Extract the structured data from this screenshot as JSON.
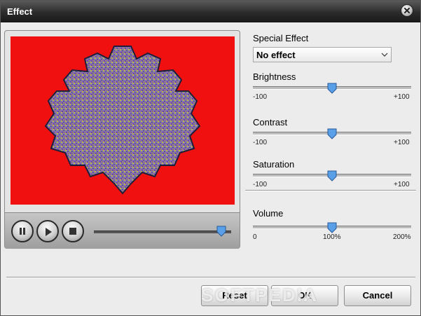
{
  "window": {
    "title": "Effect"
  },
  "player": {
    "video_background": "#f01010",
    "progress": 0.93,
    "icons": {
      "pause": "pause-icon",
      "play": "play-icon",
      "stop": "stop-icon"
    }
  },
  "special_effect": {
    "label": "Special Effect",
    "selected": "No effect"
  },
  "brightness": {
    "label": "Brightness",
    "min_label": "-100",
    "max_label": "+100",
    "value": 0
  },
  "contrast": {
    "label": "Contrast",
    "min_label": "-100",
    "max_label": "+100",
    "value": 0
  },
  "saturation": {
    "label": "Saturation",
    "min_label": "-100",
    "max_label": "+100",
    "value": 0
  },
  "volume": {
    "label": "Volume",
    "min_label": "0",
    "mid_label": "100%",
    "max_label": "200%",
    "value": 100
  },
  "buttons": {
    "reset": "Reset",
    "ok": "OK",
    "cancel": "Cancel"
  },
  "watermark": "SOFTPEDIA"
}
